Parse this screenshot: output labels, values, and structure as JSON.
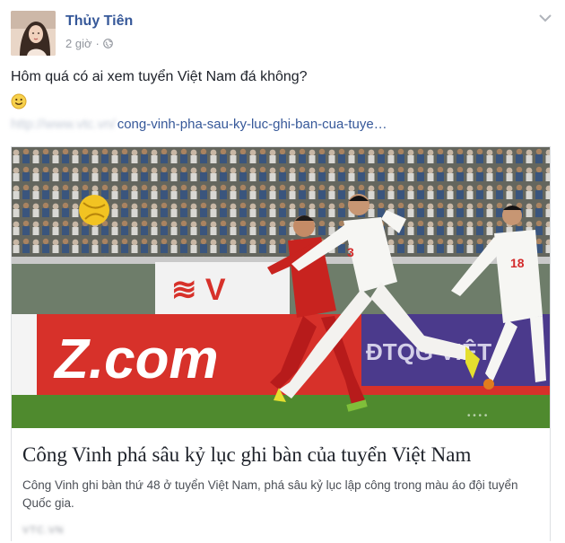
{
  "post": {
    "author": "Thủy Tiên",
    "time": "2 giờ",
    "separator": "·",
    "privacy_icon": "globe-icon",
    "menu_icon": "chevron-down-icon",
    "status_text": "Hôm quá có ai xem tuyển Việt Nam đá không?",
    "emoji": "smiley-emoji",
    "link_prefix_blurred": "http://www.vtc.vn/",
    "link_visible": "cong-vinh-pha-sau-ky-luc-ghi-ban-cua-tuye…"
  },
  "card": {
    "photo_banner_text": "Z.com",
    "photo_banner_right": "ĐTQG VIỆT",
    "player_number_left": "3",
    "player_number_right": "18",
    "title": "Công Vinh phá sâu kỷ lục ghi bàn của tuyển Việt Nam",
    "description": "Công Vinh ghi bàn thứ 48 ở tuyển Việt Nam, phá sâu kỷ lục lập công trong màu áo đội tuyển Quốc gia.",
    "domain_blurred": "VTC.VN"
  },
  "colors": {
    "link": "#365899",
    "meta": "#90949c",
    "banner_red": "#d7312a",
    "banner_purple": "#4b3a8c",
    "pitch_green": "#4f8a2e"
  }
}
